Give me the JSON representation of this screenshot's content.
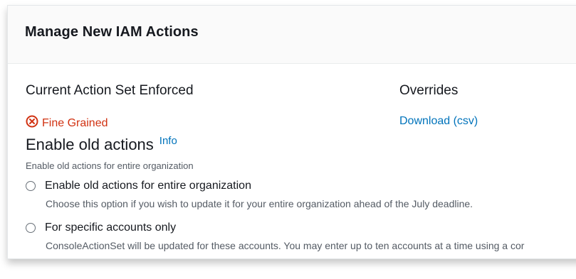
{
  "panel": {
    "title": "Manage New IAM Actions"
  },
  "current_action_set": {
    "label": "Current Action Set Enforced",
    "status_text": "Fine Grained",
    "status_icon": "error-circle-x-icon",
    "status_color": "#d13212"
  },
  "overrides": {
    "label": "Overrides",
    "download_link": "Download (csv)"
  },
  "enable_old_actions": {
    "title": "Enable old actions",
    "info_link": "Info",
    "description": "Enable old actions for entire organization",
    "options": [
      {
        "label": "Enable old actions for entire organization",
        "description": "Choose this option if you wish to update it for your entire organization ahead of the July deadline."
      },
      {
        "label": "For specific accounts only",
        "description": "ConsoleActionSet will be updated for these accounts. You may enter up to ten accounts at a time using a cor"
      }
    ]
  },
  "colors": {
    "link": "#0073bb",
    "error": "#d13212",
    "text": "#16191f",
    "secondary_text": "#545b64",
    "header_bg": "#fafafa"
  }
}
